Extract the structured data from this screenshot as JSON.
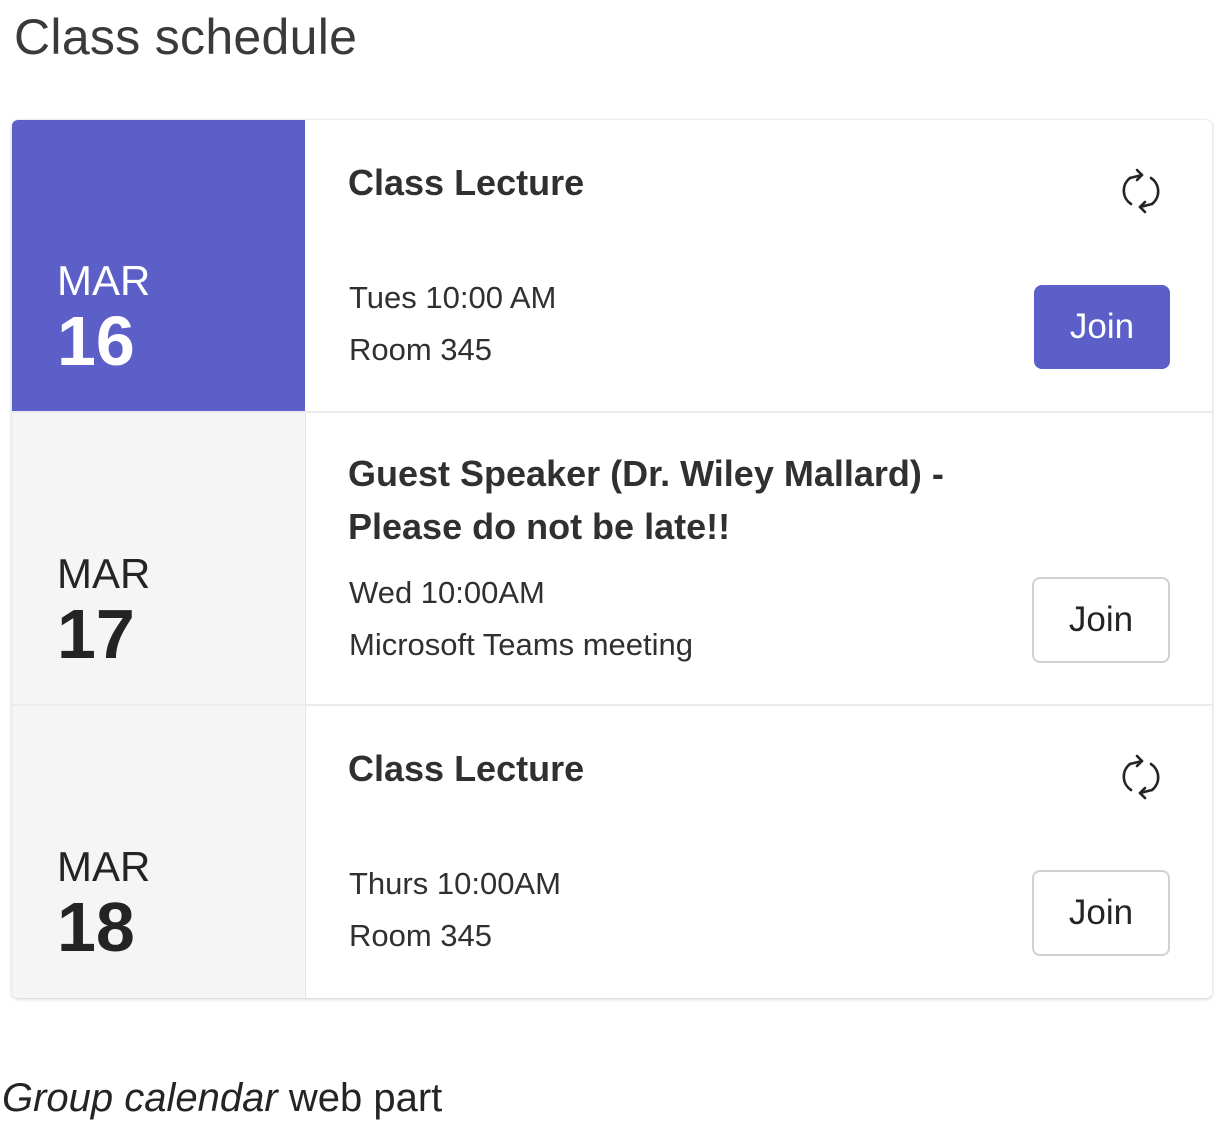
{
  "page_title": "Class schedule",
  "theme": {
    "accent": "#5b5fc7",
    "date_column_bg": "#f5f5f5",
    "text": "#242424"
  },
  "events": [
    {
      "month": "MAR",
      "day": "16",
      "title": "Class Lecture",
      "time": "Tues 10:00 AM",
      "location": "Room 345",
      "recurring": true,
      "icon": "recurring-icon",
      "join_label": "Join",
      "selected": true
    },
    {
      "month": "MAR",
      "day": "17",
      "title": "Guest Speaker (Dr. Wiley Mallard) - Please do not be late!!",
      "time": "Wed 10:00AM",
      "location": "Microsoft Teams meeting",
      "recurring": false,
      "join_label": "Join",
      "selected": false
    },
    {
      "month": "MAR",
      "day": "18",
      "title": "Class Lecture",
      "time": "Thurs 10:00AM",
      "location": "Room 345",
      "recurring": true,
      "icon": "recurring-icon",
      "join_label": "Join",
      "selected": false
    }
  ],
  "caption": {
    "italic": "Group calendar",
    "rest": " web part"
  }
}
